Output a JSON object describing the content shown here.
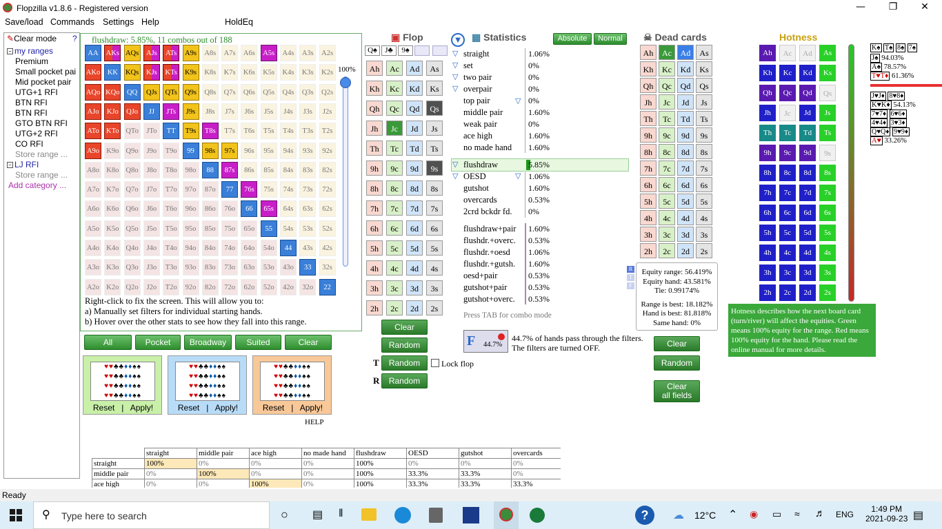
{
  "window": {
    "title": "Flopzilla v1.8.6 - Registered version"
  },
  "menu": [
    "Save/load",
    "Commands",
    "Settings",
    "Help",
    "HoldEq"
  ],
  "left": {
    "clear_mode": "Clear mode",
    "help_mark": "?",
    "category1": "my ranges",
    "items1": [
      "Premium",
      "Small pocket pai",
      "Mid pocket pair",
      "UTG+1 RFI",
      "BTN RFI",
      "BTN RFI",
      "GTO BTN RFI",
      "UTG+2 RFI",
      "CO RFI"
    ],
    "store1": "Store range ...",
    "category2": "LJ RFI",
    "store2": "Store range ...",
    "add_category": "Add category ..."
  },
  "range": {
    "header": "flushdraw: 5.85%, 11 combos out of 188",
    "percent": "100%",
    "help_lines": [
      "Right-click to fix the screen. This will allow you to:",
      "a) Manually set filters for individual starting hands.",
      "b) Hover over the other stats to see how they fall into this range."
    ],
    "rows": [
      [
        "AA",
        "AKs",
        "AQs",
        "AJs",
        "ATs",
        "A9s",
        "A8s",
        "A7s",
        "A6s",
        "A5s",
        "A4s",
        "A3s",
        "A2s"
      ],
      [
        "AKo",
        "KK",
        "KQs",
        "KJs",
        "KTs",
        "K9s",
        "K8s",
        "K7s",
        "K6s",
        "K5s",
        "K4s",
        "K3s",
        "K2s"
      ],
      [
        "AQo",
        "KQo",
        "QQ",
        "QJs",
        "QTs",
        "Q9s",
        "Q8s",
        "Q7s",
        "Q6s",
        "Q5s",
        "Q4s",
        "Q3s",
        "Q2s"
      ],
      [
        "AJo",
        "KJo",
        "QJo",
        "JJ",
        "JTs",
        "J9s",
        "J8s",
        "J7s",
        "J6s",
        "J5s",
        "J4s",
        "J3s",
        "J2s"
      ],
      [
        "ATo",
        "KTo",
        "QTo",
        "JTo",
        "TT",
        "T9s",
        "T8s",
        "T7s",
        "T6s",
        "T5s",
        "T4s",
        "T3s",
        "T2s"
      ],
      [
        "A9o",
        "K9o",
        "Q9o",
        "J9o",
        "T9o",
        "99",
        "98s",
        "97s",
        "96s",
        "95s",
        "94s",
        "93s",
        "92s"
      ],
      [
        "A8o",
        "K8o",
        "Q8o",
        "J8o",
        "T8o",
        "98o",
        "88",
        "87s",
        "86s",
        "85s",
        "84s",
        "83s",
        "82s"
      ],
      [
        "A7o",
        "K7o",
        "Q7o",
        "J7o",
        "T7o",
        "97o",
        "87o",
        "77",
        "76s",
        "75s",
        "74s",
        "73s",
        "72s"
      ],
      [
        "A6o",
        "K6o",
        "Q6o",
        "J6o",
        "T6o",
        "96o",
        "86o",
        "76o",
        "66",
        "65s",
        "64s",
        "63s",
        "62s"
      ],
      [
        "A5o",
        "K5o",
        "Q5o",
        "J5o",
        "T5o",
        "95o",
        "85o",
        "75o",
        "65o",
        "55",
        "54s",
        "53s",
        "52s"
      ],
      [
        "A4o",
        "K4o",
        "Q4o",
        "J4o",
        "T4o",
        "94o",
        "84o",
        "74o",
        "64o",
        "54o",
        "44",
        "43s",
        "42s"
      ],
      [
        "A3o",
        "K3o",
        "Q3o",
        "J3o",
        "T3o",
        "93o",
        "83o",
        "73o",
        "63o",
        "53o",
        "43o",
        "33",
        "32s"
      ],
      [
        "A2o",
        "K2o",
        "Q2o",
        "J2o",
        "T2o",
        "92o",
        "82o",
        "72o",
        "62o",
        "52o",
        "42o",
        "32o",
        "22"
      ]
    ],
    "styles": [
      [
        "b",
        "mrp",
        "yl",
        "mrp",
        "mrp",
        "yl",
        "n",
        "n",
        "n",
        "mp",
        "n",
        "n",
        "n"
      ],
      [
        "r",
        "b",
        "yl",
        "mrp",
        "mrp",
        "yl",
        "n",
        "n",
        "n",
        "n",
        "n",
        "n",
        "n"
      ],
      [
        "r",
        "r",
        "b",
        "yl",
        "yl",
        "yl",
        "n",
        "n",
        "n",
        "n",
        "n",
        "n",
        "n"
      ],
      [
        "r",
        "r",
        "r",
        "b",
        "mp",
        "yl",
        "n",
        "n",
        "n",
        "n",
        "n",
        "n",
        "n"
      ],
      [
        "r",
        "r",
        "n",
        "n",
        "b",
        "yl",
        "mp",
        "n",
        "n",
        "n",
        "n",
        "n",
        "n"
      ],
      [
        "r",
        "n",
        "n",
        "n",
        "n",
        "b",
        "yl",
        "yl",
        "n",
        "n",
        "n",
        "n",
        "n"
      ],
      [
        "n",
        "n",
        "n",
        "n",
        "n",
        "n",
        "b",
        "mp",
        "n",
        "n",
        "n",
        "n",
        "n"
      ],
      [
        "n",
        "n",
        "n",
        "n",
        "n",
        "n",
        "n",
        "b",
        "mp",
        "n",
        "n",
        "n",
        "n"
      ],
      [
        "n",
        "n",
        "n",
        "n",
        "n",
        "n",
        "n",
        "n",
        "b",
        "mp",
        "n",
        "n",
        "n"
      ],
      [
        "n",
        "n",
        "n",
        "n",
        "n",
        "n",
        "n",
        "n",
        "n",
        "b",
        "n",
        "n",
        "n"
      ],
      [
        "n",
        "n",
        "n",
        "n",
        "n",
        "n",
        "n",
        "n",
        "n",
        "n",
        "b",
        "n",
        "n"
      ],
      [
        "n",
        "n",
        "n",
        "n",
        "n",
        "n",
        "n",
        "n",
        "n",
        "n",
        "n",
        "b",
        "n"
      ],
      [
        "n",
        "n",
        "n",
        "n",
        "n",
        "n",
        "n",
        "n",
        "n",
        "n",
        "n",
        "n",
        "b"
      ]
    ]
  },
  "range_buttons": [
    "All",
    "Pocket",
    "Broadway",
    "Suited",
    "Clear"
  ],
  "suit_panels": [
    {
      "reset": "Reset",
      "sep": "|",
      "apply": "Apply!",
      "color": "#c8f0a8"
    },
    {
      "reset": "Reset",
      "sep": "|",
      "apply": "Apply!",
      "color": "#b8dcf8"
    },
    {
      "reset": "Reset",
      "sep": "|",
      "apply": "Apply!",
      "color": "#f8c898"
    }
  ],
  "help_label": "HELP",
  "flop": {
    "title": "Flop",
    "cards": [
      "Q♠",
      "J♣",
      "9♠"
    ],
    "ranks": [
      "A",
      "K",
      "Q",
      "J",
      "T",
      "9",
      "8",
      "7",
      "6",
      "5",
      "4",
      "3",
      "2"
    ],
    "clear": "Clear",
    "random": "Random",
    "turn_random": "Random",
    "river_random": "Random",
    "lock_flop": "Lock flop",
    "turn_label": "T",
    "river_label": "R"
  },
  "stats": {
    "title": "Statistics",
    "absolute": "Absolute",
    "normal": "Normal",
    "made": [
      {
        "name": "straight",
        "val": "1.06%",
        "filter": true
      },
      {
        "name": "set",
        "val": "0%",
        "filter": true
      },
      {
        "name": "two pair",
        "val": "0%",
        "filter": true
      },
      {
        "name": "overpair",
        "val": "0%",
        "filter": true
      },
      {
        "name": "top pair",
        "val": "0%",
        "filter": false
      },
      {
        "name": "middle pair",
        "val": "1.60%",
        "filter": false
      },
      {
        "name": "weak pair",
        "val": "0%",
        "filter": false
      },
      {
        "name": "ace high",
        "val": "1.60%",
        "filter": false
      },
      {
        "name": "no made hand",
        "val": "1.60%",
        "filter": false
      }
    ],
    "draws": [
      {
        "name": "flushdraw",
        "val": "5.85%"
      },
      {
        "name": "OESD",
        "val": "1.06%"
      },
      {
        "name": "gutshot",
        "val": "1.60%"
      },
      {
        "name": "overcards",
        "val": "0.53%"
      },
      {
        "name": "2crd bckdr fd.",
        "val": "0%"
      }
    ],
    "combos": [
      {
        "name": "flushdraw+pair",
        "val": "1.60%"
      },
      {
        "name": "flushdr.+overc.",
        "val": "0.53%"
      },
      {
        "name": "flushdr.+oesd",
        "val": "1.06%"
      },
      {
        "name": "flushdr.+gutsh.",
        "val": "1.60%"
      },
      {
        "name": "oesd+pair",
        "val": "0.53%"
      },
      {
        "name": "gutshot+pair",
        "val": "0.53%"
      },
      {
        "name": "gutshot+overc.",
        "val": "0.53%"
      }
    ],
    "tab_hint": "Press TAB for combo mode",
    "filter_pct": "44.7%",
    "filter_text1": "44.7% of hands pass through the filters.",
    "filter_text2": "The filters are turned OFF."
  },
  "dead": {
    "title": "Dead cards",
    "clear": "Clear",
    "random": "Random",
    "clear_all": "Clear\nall fields",
    "clear_all_1": "Clear",
    "clear_all_2": "all fields"
  },
  "equity": {
    "lines": [
      "Equity range: 56.419%",
      "Equity hand: 43.581%",
      "Tie: 0.99174%",
      "",
      "Range is best: 18.182%",
      "Hand is best: 81.818%",
      "Same hand: 0%"
    ],
    "r": "R",
    "t": "T",
    "f": "F"
  },
  "hotness": {
    "title": "Hotness",
    "desc": "Hotness describes how the next board card (turn/river) will affect the equities. Green means 100% equity for the range. Red means 100% equity for the hand. Please read the online manual for more details.",
    "styles": [
      [
        "p",
        "w",
        "w",
        "g"
      ],
      [
        "b",
        "b",
        "b",
        "g"
      ],
      [
        "p",
        "p",
        "p",
        "w"
      ],
      [
        "b",
        "w",
        "b",
        "g"
      ],
      [
        "t",
        "t",
        "t",
        "g"
      ],
      [
        "p",
        "p",
        "p",
        "w"
      ],
      [
        "b",
        "b",
        "b",
        "g"
      ],
      [
        "b",
        "b",
        "b",
        "g"
      ],
      [
        "b",
        "b",
        "b",
        "g"
      ],
      [
        "b",
        "b",
        "b",
        "g"
      ],
      [
        "b",
        "b",
        "b",
        "g"
      ],
      [
        "b",
        "b",
        "b",
        "g"
      ],
      [
        "b",
        "b",
        "b",
        "g"
      ]
    ],
    "suits": [
      "h",
      "c",
      "d",
      "s"
    ]
  },
  "right": {
    "line1_pct": "94.03%",
    "line2_pct": "78.57%",
    "line3_pct": "61.36%",
    "line4_pct": "54.13%",
    "line5_pct": "33.26%"
  },
  "table": {
    "headers": [
      "",
      "straight",
      "middle pair",
      "ace high",
      "no made hand",
      "flushdraw",
      "OESD",
      "gutshot",
      "overcards"
    ],
    "rows": [
      [
        "straight",
        "100%",
        "0%",
        "0%",
        "0%",
        "100%",
        "0%",
        "0%",
        "0%"
      ],
      [
        "middle pair",
        "0%",
        "100%",
        "0%",
        "0%",
        "100%",
        "33.3%",
        "33.3%",
        "0%"
      ],
      [
        "ace high",
        "0%",
        "0%",
        "100%",
        "0%",
        "100%",
        "33.3%",
        "33.3%",
        "33.3%"
      ]
    ]
  },
  "status": "Ready",
  "taskbar": {
    "search": "Type here to search",
    "temp": "12°C",
    "lang": "ENG",
    "time": "1:49 PM",
    "date": "2021-09-23"
  }
}
